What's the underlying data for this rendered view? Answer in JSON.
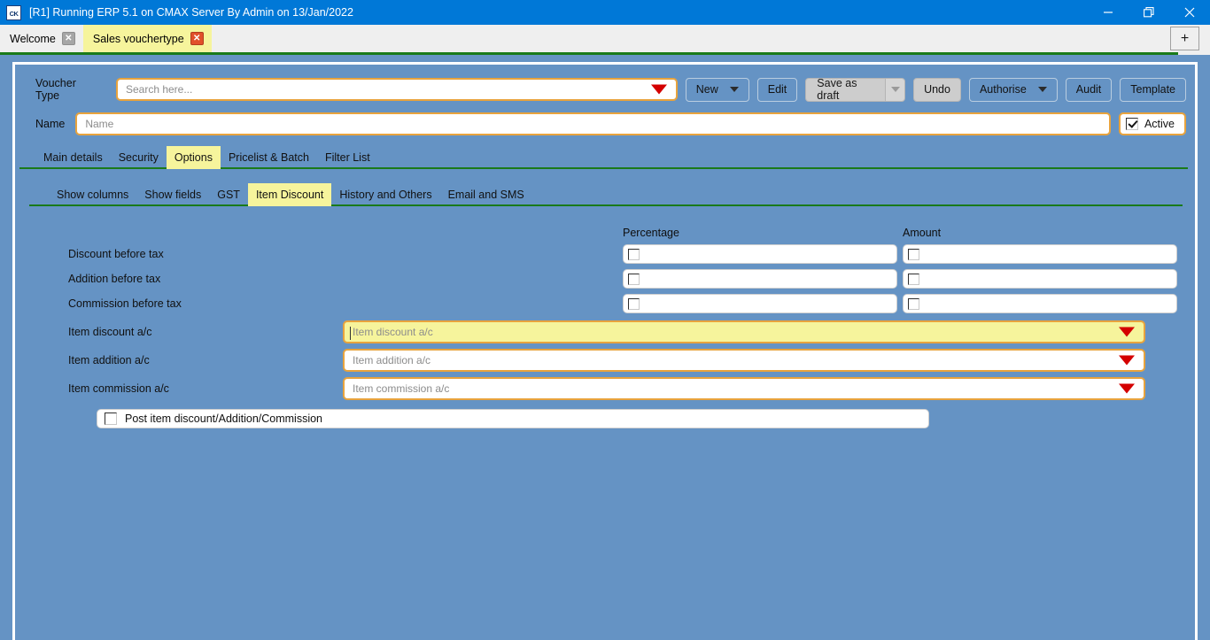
{
  "window": {
    "title": "[R1] Running ERP 5.1 on CMAX Server By Admin on 13/Jan/2022",
    "logo_text": "CK",
    "minimize_label": "Minimize",
    "maximize_label": "Restore",
    "close_label": "Close"
  },
  "tabstrip": {
    "tabs": [
      {
        "label": "Welcome",
        "active": false,
        "close": "✕"
      },
      {
        "label": "Sales vouchertype",
        "active": true,
        "close": "✕"
      }
    ],
    "new_tab_label": "+"
  },
  "form": {
    "voucher_type_label": "Voucher Type",
    "voucher_type_placeholder": "Search here...",
    "name_label": "Name",
    "name_placeholder": "Name",
    "active_label": "Active",
    "active_checked": true
  },
  "toolbar": {
    "new_label": "New",
    "edit_label": "Edit",
    "save_as_draft_label": "Save as draft",
    "undo_label": "Undo",
    "authorise_label": "Authorise",
    "audit_label": "Audit",
    "template_label": "Template"
  },
  "main_tabs": [
    {
      "label": "Main details",
      "active": false
    },
    {
      "label": "Security",
      "active": false
    },
    {
      "label": "Options",
      "active": true
    },
    {
      "label": "Pricelist & Batch",
      "active": false
    },
    {
      "label": "Filter List",
      "active": false
    }
  ],
  "sub_tabs": [
    {
      "label": "Show columns",
      "active": false
    },
    {
      "label": "Show fields",
      "active": false
    },
    {
      "label": "GST",
      "active": false
    },
    {
      "label": "Item Discount",
      "active": true
    },
    {
      "label": "History and Others",
      "active": false
    },
    {
      "label": "Email and SMS",
      "active": false
    }
  ],
  "grid": {
    "col_percentage": "Percentage",
    "col_amount": "Amount",
    "check_rows": [
      {
        "label": "Discount before tax",
        "percentage_checked": false,
        "amount_checked": false
      },
      {
        "label": "Addition before tax",
        "percentage_checked": false,
        "amount_checked": false
      },
      {
        "label": "Commission before tax",
        "percentage_checked": false,
        "amount_checked": false
      }
    ],
    "account_rows": [
      {
        "label": "Item discount a/c",
        "placeholder": "Item discount a/c",
        "focused": true
      },
      {
        "label": "Item addition a/c",
        "placeholder": "Item addition a/c",
        "focused": false
      },
      {
        "label": "Item commission a/c",
        "placeholder": "Item commission a/c",
        "focused": false
      }
    ],
    "post_label": "Post item discount/Addition/Commission",
    "post_checked": false
  },
  "colors": {
    "titlebar": "#0078d7",
    "workspace": "#6593c4",
    "active_tab": "#f6f49c",
    "field_border": "#e8a33d",
    "rule": "#1a7a1a",
    "dropdown_arrow": "#d40000"
  }
}
